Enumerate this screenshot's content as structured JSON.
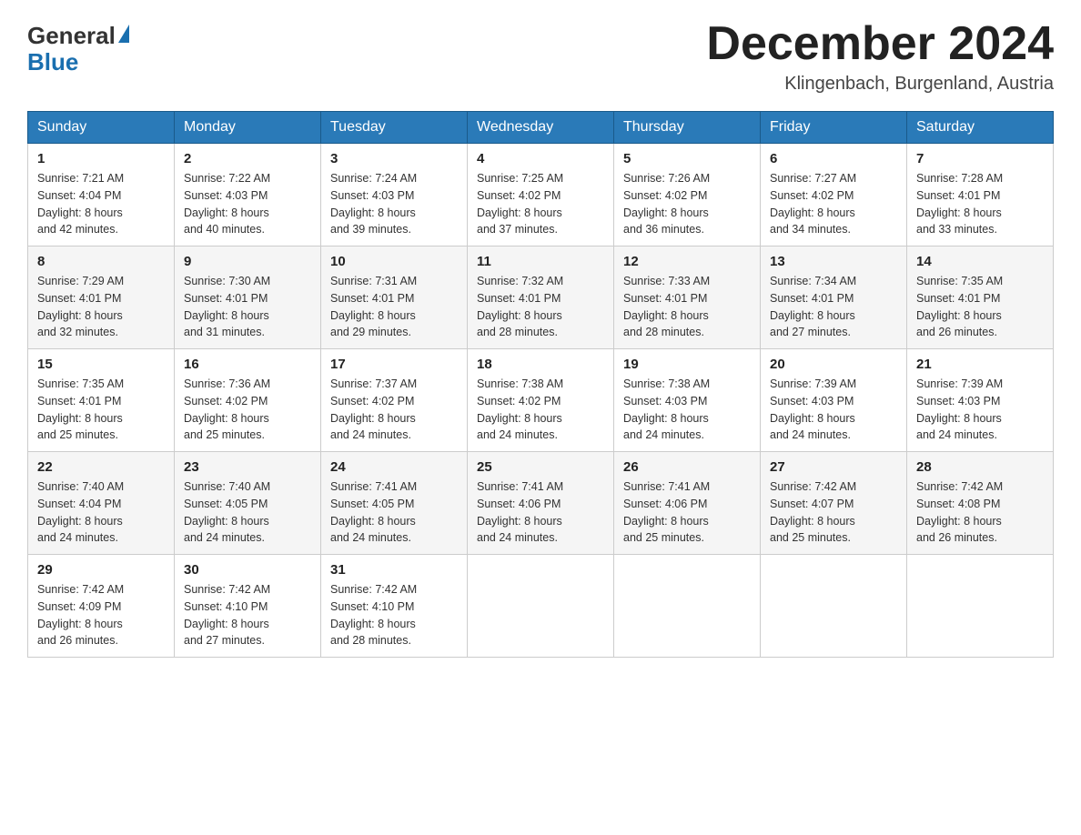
{
  "header": {
    "logo": {
      "general": "General",
      "blue": "Blue"
    },
    "title": "December 2024",
    "location": "Klingenbach, Burgenland, Austria"
  },
  "days_of_week": [
    "Sunday",
    "Monday",
    "Tuesday",
    "Wednesday",
    "Thursday",
    "Friday",
    "Saturday"
  ],
  "weeks": [
    [
      {
        "day": "1",
        "sunrise": "7:21 AM",
        "sunset": "4:04 PM",
        "daylight": "8 hours and 42 minutes."
      },
      {
        "day": "2",
        "sunrise": "7:22 AM",
        "sunset": "4:03 PM",
        "daylight": "8 hours and 40 minutes."
      },
      {
        "day": "3",
        "sunrise": "7:24 AM",
        "sunset": "4:03 PM",
        "daylight": "8 hours and 39 minutes."
      },
      {
        "day": "4",
        "sunrise": "7:25 AM",
        "sunset": "4:02 PM",
        "daylight": "8 hours and 37 minutes."
      },
      {
        "day": "5",
        "sunrise": "7:26 AM",
        "sunset": "4:02 PM",
        "daylight": "8 hours and 36 minutes."
      },
      {
        "day": "6",
        "sunrise": "7:27 AM",
        "sunset": "4:02 PM",
        "daylight": "8 hours and 34 minutes."
      },
      {
        "day": "7",
        "sunrise": "7:28 AM",
        "sunset": "4:01 PM",
        "daylight": "8 hours and 33 minutes."
      }
    ],
    [
      {
        "day": "8",
        "sunrise": "7:29 AM",
        "sunset": "4:01 PM",
        "daylight": "8 hours and 32 minutes."
      },
      {
        "day": "9",
        "sunrise": "7:30 AM",
        "sunset": "4:01 PM",
        "daylight": "8 hours and 31 minutes."
      },
      {
        "day": "10",
        "sunrise": "7:31 AM",
        "sunset": "4:01 PM",
        "daylight": "8 hours and 29 minutes."
      },
      {
        "day": "11",
        "sunrise": "7:32 AM",
        "sunset": "4:01 PM",
        "daylight": "8 hours and 28 minutes."
      },
      {
        "day": "12",
        "sunrise": "7:33 AM",
        "sunset": "4:01 PM",
        "daylight": "8 hours and 28 minutes."
      },
      {
        "day": "13",
        "sunrise": "7:34 AM",
        "sunset": "4:01 PM",
        "daylight": "8 hours and 27 minutes."
      },
      {
        "day": "14",
        "sunrise": "7:35 AM",
        "sunset": "4:01 PM",
        "daylight": "8 hours and 26 minutes."
      }
    ],
    [
      {
        "day": "15",
        "sunrise": "7:35 AM",
        "sunset": "4:01 PM",
        "daylight": "8 hours and 25 minutes."
      },
      {
        "day": "16",
        "sunrise": "7:36 AM",
        "sunset": "4:02 PM",
        "daylight": "8 hours and 25 minutes."
      },
      {
        "day": "17",
        "sunrise": "7:37 AM",
        "sunset": "4:02 PM",
        "daylight": "8 hours and 24 minutes."
      },
      {
        "day": "18",
        "sunrise": "7:38 AM",
        "sunset": "4:02 PM",
        "daylight": "8 hours and 24 minutes."
      },
      {
        "day": "19",
        "sunrise": "7:38 AM",
        "sunset": "4:03 PM",
        "daylight": "8 hours and 24 minutes."
      },
      {
        "day": "20",
        "sunrise": "7:39 AM",
        "sunset": "4:03 PM",
        "daylight": "8 hours and 24 minutes."
      },
      {
        "day": "21",
        "sunrise": "7:39 AM",
        "sunset": "4:03 PM",
        "daylight": "8 hours and 24 minutes."
      }
    ],
    [
      {
        "day": "22",
        "sunrise": "7:40 AM",
        "sunset": "4:04 PM",
        "daylight": "8 hours and 24 minutes."
      },
      {
        "day": "23",
        "sunrise": "7:40 AM",
        "sunset": "4:05 PM",
        "daylight": "8 hours and 24 minutes."
      },
      {
        "day": "24",
        "sunrise": "7:41 AM",
        "sunset": "4:05 PM",
        "daylight": "8 hours and 24 minutes."
      },
      {
        "day": "25",
        "sunrise": "7:41 AM",
        "sunset": "4:06 PM",
        "daylight": "8 hours and 24 minutes."
      },
      {
        "day": "26",
        "sunrise": "7:41 AM",
        "sunset": "4:06 PM",
        "daylight": "8 hours and 25 minutes."
      },
      {
        "day": "27",
        "sunrise": "7:42 AM",
        "sunset": "4:07 PM",
        "daylight": "8 hours and 25 minutes."
      },
      {
        "day": "28",
        "sunrise": "7:42 AM",
        "sunset": "4:08 PM",
        "daylight": "8 hours and 26 minutes."
      }
    ],
    [
      {
        "day": "29",
        "sunrise": "7:42 AM",
        "sunset": "4:09 PM",
        "daylight": "8 hours and 26 minutes."
      },
      {
        "day": "30",
        "sunrise": "7:42 AM",
        "sunset": "4:10 PM",
        "daylight": "8 hours and 27 minutes."
      },
      {
        "day": "31",
        "sunrise": "7:42 AM",
        "sunset": "4:10 PM",
        "daylight": "8 hours and 28 minutes."
      },
      null,
      null,
      null,
      null
    ]
  ],
  "labels": {
    "sunrise": "Sunrise:",
    "sunset": "Sunset:",
    "daylight": "Daylight:"
  }
}
